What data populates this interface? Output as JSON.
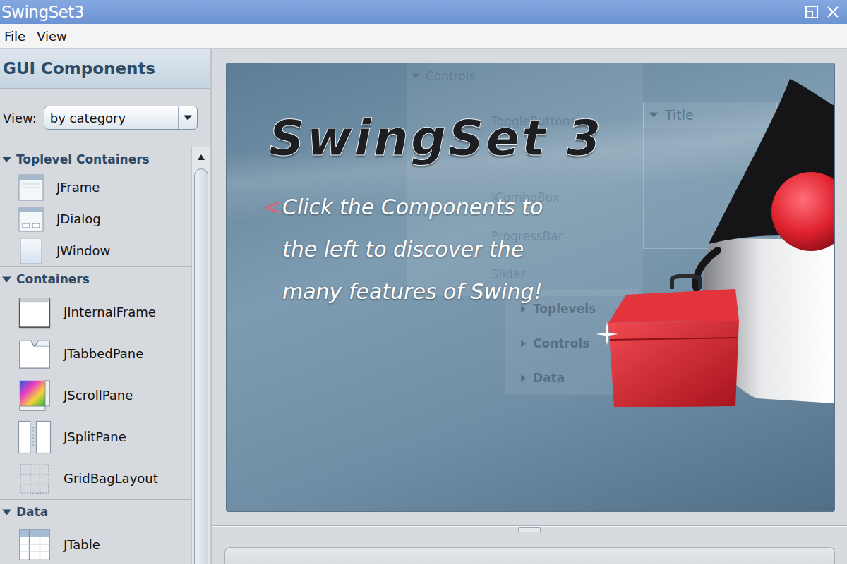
{
  "window": {
    "title": "SwingSet3"
  },
  "menu": [
    {
      "label": "File"
    },
    {
      "label": "View"
    }
  ],
  "sidebar": {
    "title": "GUI Components",
    "view_label": "View:",
    "view_value": "by category",
    "categories": [
      {
        "label": "Toplevel Containers",
        "expanded": true,
        "items": [
          {
            "label": "JFrame",
            "kind": "frame",
            "selected": false
          },
          {
            "label": "JDialog",
            "kind": "dialog",
            "selected": false
          },
          {
            "label": "JWindow",
            "kind": "window",
            "selected": false
          }
        ]
      },
      {
        "label": "Containers",
        "expanded": true,
        "items": [
          {
            "label": "JInternalFrame",
            "kind": "internalframe",
            "selected": false
          },
          {
            "label": "JTabbedPane",
            "kind": "tabbedpane",
            "selected": false
          },
          {
            "label": "JScrollPane",
            "kind": "scrollpane",
            "selected": false
          },
          {
            "label": "JSplitPane",
            "kind": "splitpane",
            "selected": false
          },
          {
            "label": "GridBagLayout",
            "kind": "grid",
            "selected": false
          }
        ]
      },
      {
        "label": "Data",
        "expanded": true,
        "items": [
          {
            "label": "JTable",
            "kind": "table",
            "selected": false
          }
        ]
      }
    ]
  },
  "splash": {
    "logo": "SwingSet 3",
    "pointer": "<",
    "lines": [
      "Click the Components to",
      "the left to discover the",
      "many features of Swing!"
    ],
    "ghost": {
      "header": "Controls",
      "controls": [
        "ToggleButtons",
        "JComboBox",
        "ProgressBar",
        "Slider"
      ],
      "table_header": "Title",
      "sections": [
        "Toplevels",
        "Controls",
        "Data"
      ]
    }
  }
}
